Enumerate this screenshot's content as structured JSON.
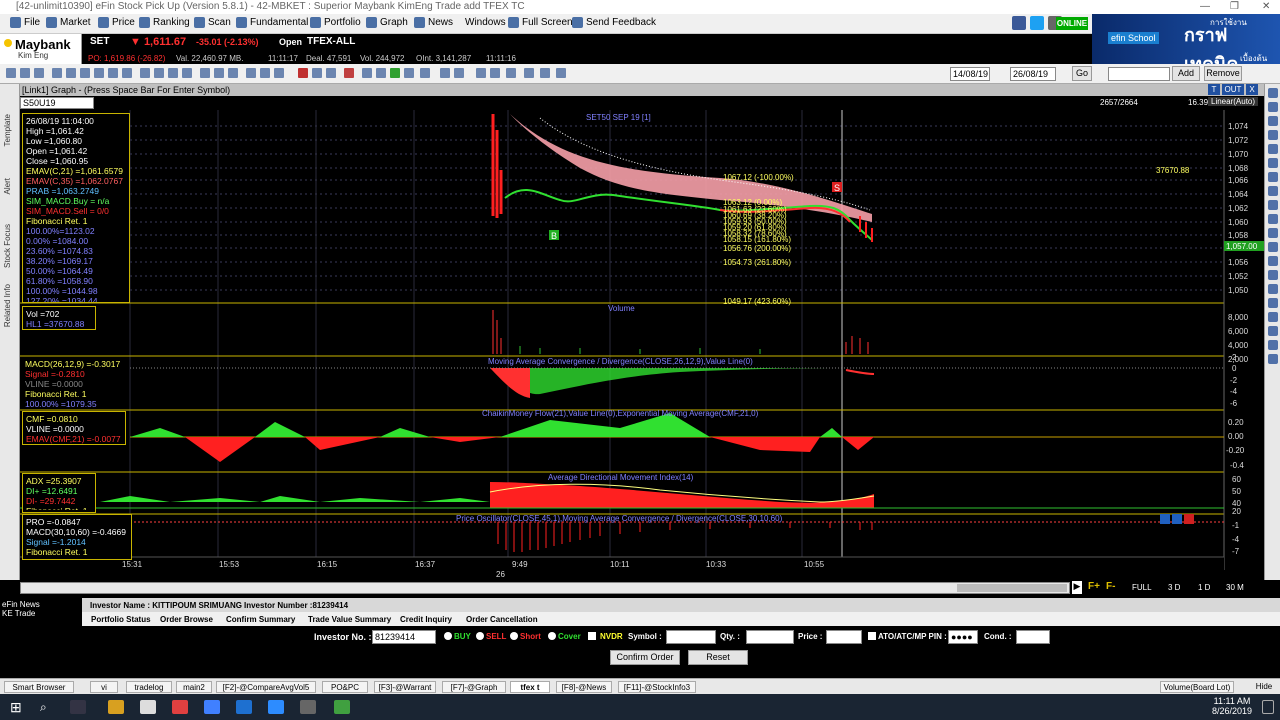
{
  "window": {
    "title": "[42-unlimit10390] eFin Stock Pick Up (Version 5.8.1) - 42-MBKET : Superior Maybank KimEng Trade add TFEX TC"
  },
  "menu": [
    "File",
    "Market",
    "Price",
    "Ranking",
    "Scan",
    "Fundamental",
    "Portfolio",
    "Graph",
    "News",
    "Windows",
    "Full Screen",
    "Send Feedback"
  ],
  "status": {
    "online": "ONLINE"
  },
  "banner": {
    "brand": "efin School",
    "text": "กราฟเทคนิค",
    "top": "การใช้งาน",
    "sub": "เบื้องต้น"
  },
  "brand": {
    "name": "Maybank",
    "sub": "Kim Eng"
  },
  "ticker": {
    "market": "SET",
    "index": "▼ 1,611.67",
    "change": "-35.01 (-2.13%)",
    "session": "Open",
    "tfex": "TFEX-ALL",
    "po": "PO: 1,619.86 (-26.82)",
    "val": "Val. 22,460.97 MB.",
    "t1": "11:11:17",
    "deal": "Deal. 47,591",
    "vol": "Vol. 244,972",
    "oint": "OInt. 3,141,287",
    "t2": "11:11:16"
  },
  "toolbar": {
    "date_from": "14/08/19",
    "date_to": "26/08/19",
    "go": "Go",
    "add": "Add",
    "remove": "Remove"
  },
  "graph": {
    "title": "[Link1] Graph - (Press Space Bar For Enter Symbol)",
    "symbol": "S50U19",
    "bars": "2657/2664",
    "zoom": "16.39",
    "scale": "Linear(Auto)",
    "t": "T",
    "out": "OUT",
    "x": "X"
  },
  "side_tabs": [
    "Template",
    "Alert",
    "Stock Focus",
    "Related Info"
  ],
  "info_main": [
    "26/08/19 11:04:00",
    "High =1,061.42",
    "Low =1,060.80",
    "Open =1,061.42",
    "Close =1,060.95",
    "EMAV(C,21) =1,061.6579",
    "EMAV(C,35) =1,062.0767",
    "PRAB =1,063.2749",
    "SIM_MACD.Buy = n/a",
    "SIM_MACD.Sell = 0/0",
    "Fibonacci Ret. 1",
    "100.00%=1123.02",
    "0.00% =1084.00",
    "23.60% =1074.83",
    "38.20% =1069.17",
    "50.00% =1064.49",
    "61.80% =1058.90",
    "100.00% =1044.98",
    "127.20% =1034.44"
  ],
  "info_vol": [
    "Vol =702",
    "HL1 =37670.88"
  ],
  "info_macd": [
    "MACD(26,12,9) =-0.3017",
    "Signal =-0.2810",
    "VLINE =0.0000",
    "Fibonacci Ret. 1",
    "100.00% =1079.35"
  ],
  "info_cmf": [
    "CMF =0.0810",
    "VLINE =0.0000",
    "EMAV(CMF,21) =-0.0077"
  ],
  "info_adx": [
    "ADX =25.3907",
    "DI+ =12.6491",
    "DI- =29.7442",
    "Fibonacci Ret. 1"
  ],
  "info_pro": [
    "PRO =-0.0847",
    "MACD(30,10,60) =-0.4669",
    "Signal =-1.2014",
    "Fibonacci Ret. 1"
  ],
  "chart_titles": {
    "price": "SET50 SEP 19 [1]",
    "volume": "Volume",
    "macd": "Moving Average Convergence / Divergence(CLOSE,26,12,9),Value Line(0)",
    "cmf": "ChaikinMoney Flow(21),Value Line(0),Exponential Moving Average(CMF,21,0)",
    "adx": "Average Directional Movement Index(14)",
    "pro": "Price Oscillator(CLOSE,45,1),Moving Average Convergence / Divergence(CLOSE,30,10,60)"
  },
  "fib_labels": [
    "1067.12 (-100.00%)",
    "1063.12 (0.00%)",
    "1061.63 (23.60%)",
    "1060.69 (38.20%)",
    "1059.93 (50.00%)",
    "1059.20 (61.80%)",
    "1058.32 (78.60%)",
    "1058.15 (161.80%)",
    "1056.76 (200.00%)",
    "1054.73 (261.80%)",
    "1049.17 (423.60%)"
  ],
  "hl_label": "37670.88",
  "markers": {
    "buy": "B",
    "sell": "S"
  },
  "price_axis": [
    "1,074",
    "1,072",
    "1,070",
    "1,068",
    "1,066",
    "1,064",
    "1,062",
    "1,060",
    "1,058",
    "1,056",
    "1,054",
    "1,052",
    "1,050"
  ],
  "current_price": "1,057.00",
  "vol_axis": [
    "8,000",
    "6,000",
    "4,000",
    "2,000"
  ],
  "macd_axis": [
    "2",
    "0",
    "-2",
    "-4",
    "-6"
  ],
  "cmf_axis": [
    "0.20",
    "0.00",
    "-0.20",
    "-0.4"
  ],
  "adx_axis": [
    "60",
    "50",
    "40",
    "20"
  ],
  "pro_axis": [
    "-1",
    "-4",
    "-7"
  ],
  "time_axis": [
    "15:31",
    "15:53",
    "16:15",
    "16:37",
    "9:49",
    "10:11",
    "10:33",
    "10:55"
  ],
  "date_mark": "26",
  "scroll_controls": [
    "F+",
    "F-",
    "FULL",
    "3 D",
    "1 D",
    "30 M"
  ],
  "lower_left": [
    "eFin News",
    "KE Trade"
  ],
  "investor": {
    "name_label": "Investor Name : KITTIPOUM SRIMUANG",
    "num_label": "Investor Number :81239414"
  },
  "order_tabs": [
    "Portfolio Status",
    "Order Browse",
    "Confirm Summary",
    "Trade Value Summary",
    "Credit Inquiry",
    "Order Cancellation"
  ],
  "order_form": {
    "inv_label": "Investor No. :",
    "inv_value": "81239414",
    "buy": "BUY",
    "sell": "SELL",
    "short": "Short",
    "cover": "Cover",
    "nvdr": "NVDR",
    "symbol": "Symbol :",
    "qty": "Qty. :",
    "price": "Price :",
    "atc": "ATO/ATC/MP PIN :",
    "pin": "●●●●",
    "cond": "Cond. :",
    "confirm": "Confirm Order",
    "reset": "Reset"
  },
  "task_tabs": [
    "Smart Browser",
    "vi",
    "tradelog",
    "main2",
    "[F2]-@CompareAvgVol5",
    "PO&PC",
    "[F3]-@Warrant",
    "[F7]-@Graph",
    "tfex t",
    "[F8]-@News",
    "[F11]-@StockInfo3"
  ],
  "board": "Volume(Board Lot)",
  "hide": "Hide",
  "clock": {
    "time": "11:11 AM",
    "date": "8/26/2019"
  }
}
